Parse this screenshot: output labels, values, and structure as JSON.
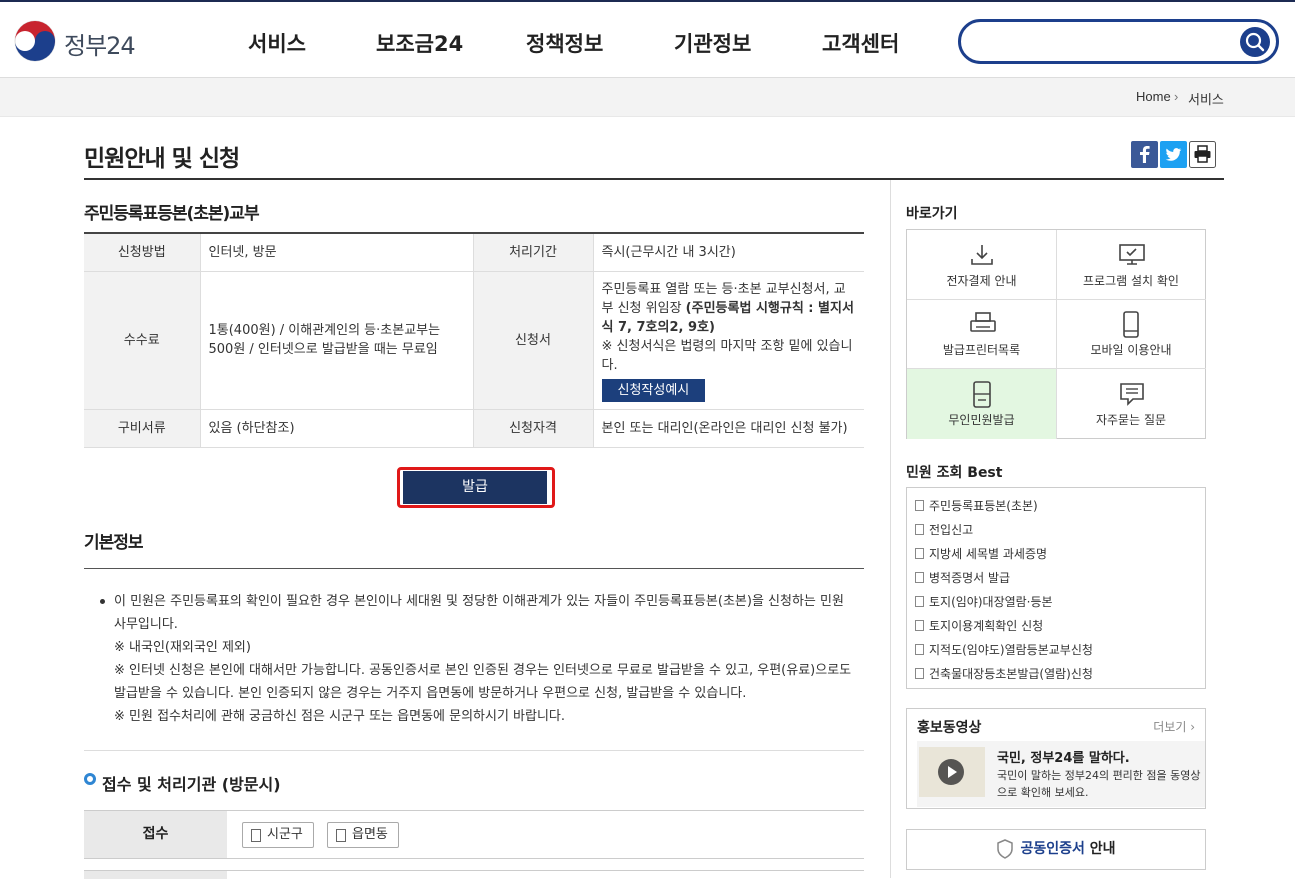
{
  "header": {
    "logo_text": "정부24",
    "nav": [
      "서비스",
      "보조금24",
      "정책정보",
      "기관정보",
      "고객센터"
    ],
    "search_placeholder": ""
  },
  "breadcrumb": {
    "home": "Home",
    "current": "서비스"
  },
  "page_title": "민원안내 및 신청",
  "service": {
    "title": "주민등록표등본(초본)교부",
    "rows": [
      {
        "l1": "신청방법",
        "v1": "인터넷, 방문",
        "l2": "처리기간",
        "v2": "즉시(근무시간 내 3시간)"
      },
      {
        "l1": "수수료",
        "v1": "1통(400원) / 이해관계인의 등·초본교부는 500원 / 인터넷으로 발급받을 때는 무료임",
        "l2": "신청서",
        "v2_pre": "주민등록표 열람 또는 등·초본 교부신청서, 교부 신청 위임장 ",
        "v2_bold": "(주민등록법 시행규칙 : 별지서식 7, 7호의2, 9호)",
        "v2_note": "※ 신청서식은 법령의 마지막 조항 밑에 있습니다.",
        "v2_button": "신청작성예시"
      },
      {
        "l1": "구비서류",
        "v1": "있음 (하단참조)",
        "l2": "신청자격",
        "v2": "본인 또는 대리인(온라인은 대리인 신청 불가)"
      }
    ],
    "issue_button": "발급"
  },
  "basic": {
    "title": "기본정보",
    "lines": [
      " 이 민원은 주민등록표의 확인이 필요한 경우 본인이나 세대원 및 정당한 이해관계가 있는 자들이 주민등록표등본(초본)을 신청하는 민원",
      "사무입니다.",
      "※ 내국인(재외국인 제외)",
      "※ 인터넷 신청은 본인에 대해서만 가능합니다. 공동인증서로 본인 인증된 경우는 인터넷으로 무료로 발급받을 수 있고, 우편(유료)으로도",
      "발급받을 수 있습니다. 본인 인증되지 않은 경우는 거주지 읍면동에 방문하거나 우편으로 신청, 발급받을 수 있습니다.",
      "※ 민원 접수처리에 관해 궁금하신 점은 시군구 또는 읍면동에 문의하시기 바랍니다."
    ]
  },
  "reception": {
    "title": "접수 및 처리기관 (방문시)",
    "label": "접수",
    "chips": [
      "시군구",
      "읍면동"
    ]
  },
  "sidebar": {
    "quick_title": "바로가기",
    "quick": [
      {
        "label": "전자결제 안내",
        "icon": "download-icon"
      },
      {
        "label": "프로그램 설치 확인",
        "icon": "monitor-icon"
      },
      {
        "label": "발급프린터목록",
        "icon": "printer-icon"
      },
      {
        "label": "모바일 이용안내",
        "icon": "mobile-icon"
      },
      {
        "label": "무인민원발급",
        "icon": "kiosk-icon"
      },
      {
        "label": "자주묻는 질문",
        "icon": "chat-icon"
      }
    ],
    "best_title": "민원 조회 Best",
    "best": [
      "주민등록표등본(초본)",
      "전입신고",
      "지방세 세목별 과세증명",
      "병적증명서 발급",
      "토지(임야)대장열람·등본",
      "토지이용계획확인 신청",
      "지적도(임야도)열람등본교부신청",
      "건축물대장등초본발급(열람)신청"
    ],
    "promo": {
      "title": "홍보동영상",
      "more": "더보기 ›",
      "heading": "국민, 정부24를 말하다.",
      "desc": "국민이 말하는 정부24의 편리한 점을 동영상으로 확인해 보세요."
    },
    "cert": {
      "highlight": "공동인증서",
      "rest": " 안내"
    }
  },
  "colors": {
    "primary": "#1c3f8c",
    "issue_button": "#1c3461",
    "highlight_border": "#e01818",
    "kiosk_bg": "#e3f7e1"
  }
}
